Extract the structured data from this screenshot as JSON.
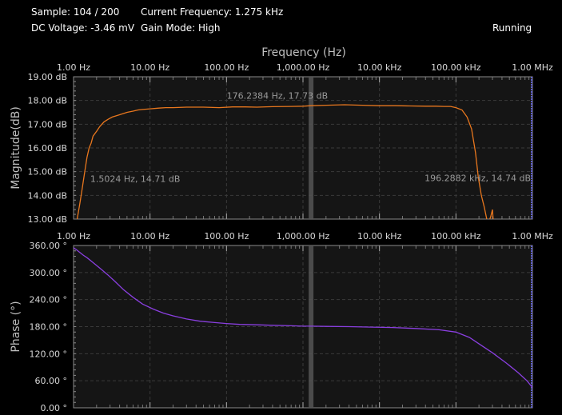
{
  "status": {
    "sample_label": "Sample: 104 / 200",
    "frequency_label": "Current Frequency: 1.275 kHz",
    "dc_voltage_label": "DC Voltage: -3.46 mV",
    "gain_mode_label": "Gain Mode: High",
    "run_state": "Running"
  },
  "colors": {
    "background": "#000000",
    "plot_background": "#151515",
    "magnitude_trace": "#e8771e",
    "phase_trace": "#8a3fe0",
    "cursor": "#555555",
    "edge_marker": "#6060d0"
  },
  "chart_data": [
    {
      "type": "line",
      "title": "Frequency (Hz)",
      "xlabel": "Frequency (Hz)",
      "ylabel": "Magnitude(dB)",
      "x_scale": "log",
      "xlim": [
        1,
        1000000
      ],
      "ylim": [
        13,
        19
      ],
      "x_tick_labels": [
        "1.00 Hz",
        "10.00 Hz",
        "100.00 Hz",
        "1,000.00 Hz",
        "10.00 kHz",
        "100.00 kHz",
        "1.00 MHz"
      ],
      "y_tick_labels": [
        "19.00 dB",
        "18.00 dB",
        "17.00 dB",
        "16.00 dB",
        "15.00 dB",
        "14.00 dB",
        "13.00 dB"
      ],
      "y_ticks": [
        19,
        18,
        17,
        16,
        15,
        14,
        13
      ],
      "grid": true,
      "cursor_x": 1275,
      "annotations": [
        {
          "text": "1.5024 Hz, 14.71 dB",
          "x": 1.5024,
          "y": 14.71
        },
        {
          "text": "176.2384 Hz, 17.73 dB",
          "x": 176.2384,
          "y": 17.73
        },
        {
          "text": "196.2882 kHz, 14.74 dB",
          "x": 196288.2,
          "y": 14.74
        }
      ],
      "series": [
        {
          "x": [
            1.1,
            1.2,
            1.3,
            1.4,
            1.5,
            1.6,
            1.7,
            1.8,
            2.0,
            2.2,
            2.5,
            2.8,
            3.2,
            3.6,
            4.0,
            5.0,
            6.0,
            7.0,
            8.0,
            10,
            13,
            16,
            20,
            30,
            50,
            80,
            120,
            176,
            250,
            400,
            700,
            1000,
            1275,
            2000,
            3500,
            6000,
            10000,
            16000,
            25000,
            40000,
            55000,
            70000,
            85000,
            100000,
            120000,
            140000,
            160000,
            180000,
            196288,
            215000,
            235000,
            255000,
            270000,
            285000,
            300000,
            310000
          ],
          "y": [
            12.9,
            13.6,
            14.3,
            15.0,
            15.6,
            16.0,
            16.2,
            16.5,
            16.7,
            16.9,
            17.1,
            17.2,
            17.3,
            17.35,
            17.4,
            17.5,
            17.55,
            17.6,
            17.62,
            17.65,
            17.68,
            17.7,
            17.7,
            17.72,
            17.72,
            17.7,
            17.73,
            17.73,
            17.72,
            17.74,
            17.75,
            17.76,
            17.78,
            17.8,
            17.82,
            17.8,
            17.78,
            17.78,
            17.77,
            17.76,
            17.76,
            17.75,
            17.75,
            17.7,
            17.6,
            17.3,
            16.8,
            15.8,
            14.74,
            14.0,
            13.5,
            12.95,
            12.9,
            13.1,
            13.4,
            12.8
          ]
        }
      ]
    },
    {
      "type": "line",
      "ylabel": "Phase (°)",
      "x_scale": "log",
      "xlim": [
        1,
        1000000
      ],
      "ylim": [
        0,
        360
      ],
      "x_tick_labels": [
        "1.00 Hz",
        "10.00 Hz",
        "100.00 Hz",
        "1,000.00 Hz",
        "10.00 kHz",
        "100.00 kHz",
        "1.00 MHz"
      ],
      "y_tick_labels": [
        "360.00 °",
        "300.00 °",
        "240.00 °",
        "180.00 °",
        "120.00 °",
        "60.00 °",
        "0.00 °"
      ],
      "y_ticks": [
        360,
        300,
        240,
        180,
        120,
        60,
        0
      ],
      "grid": true,
      "cursor_x": 1275,
      "series": [
        {
          "x": [
            1.0,
            1.1,
            1.2,
            1.35,
            1.5,
            1.8,
            2.2,
            2.8,
            3.5,
            4.5,
            6.0,
            8.0,
            11,
            15,
            20,
            30,
            45,
            70,
            100,
            150,
            250,
            400,
            700,
            1000,
            1275,
            2000,
            4000,
            8000,
            15000,
            30000,
            60000,
            100000,
            150000,
            200000,
            300000,
            450000,
            650000,
            850000,
            1000000
          ],
          "y": [
            355,
            350,
            345,
            338,
            333,
            322,
            310,
            295,
            280,
            262,
            245,
            230,
            219,
            210,
            204,
            197,
            192,
            189,
            187,
            185,
            184,
            183,
            182,
            181,
            181,
            180.5,
            180,
            179,
            178,
            176,
            173,
            168,
            156,
            142,
            122,
            100,
            78,
            60,
            45
          ]
        }
      ]
    }
  ]
}
